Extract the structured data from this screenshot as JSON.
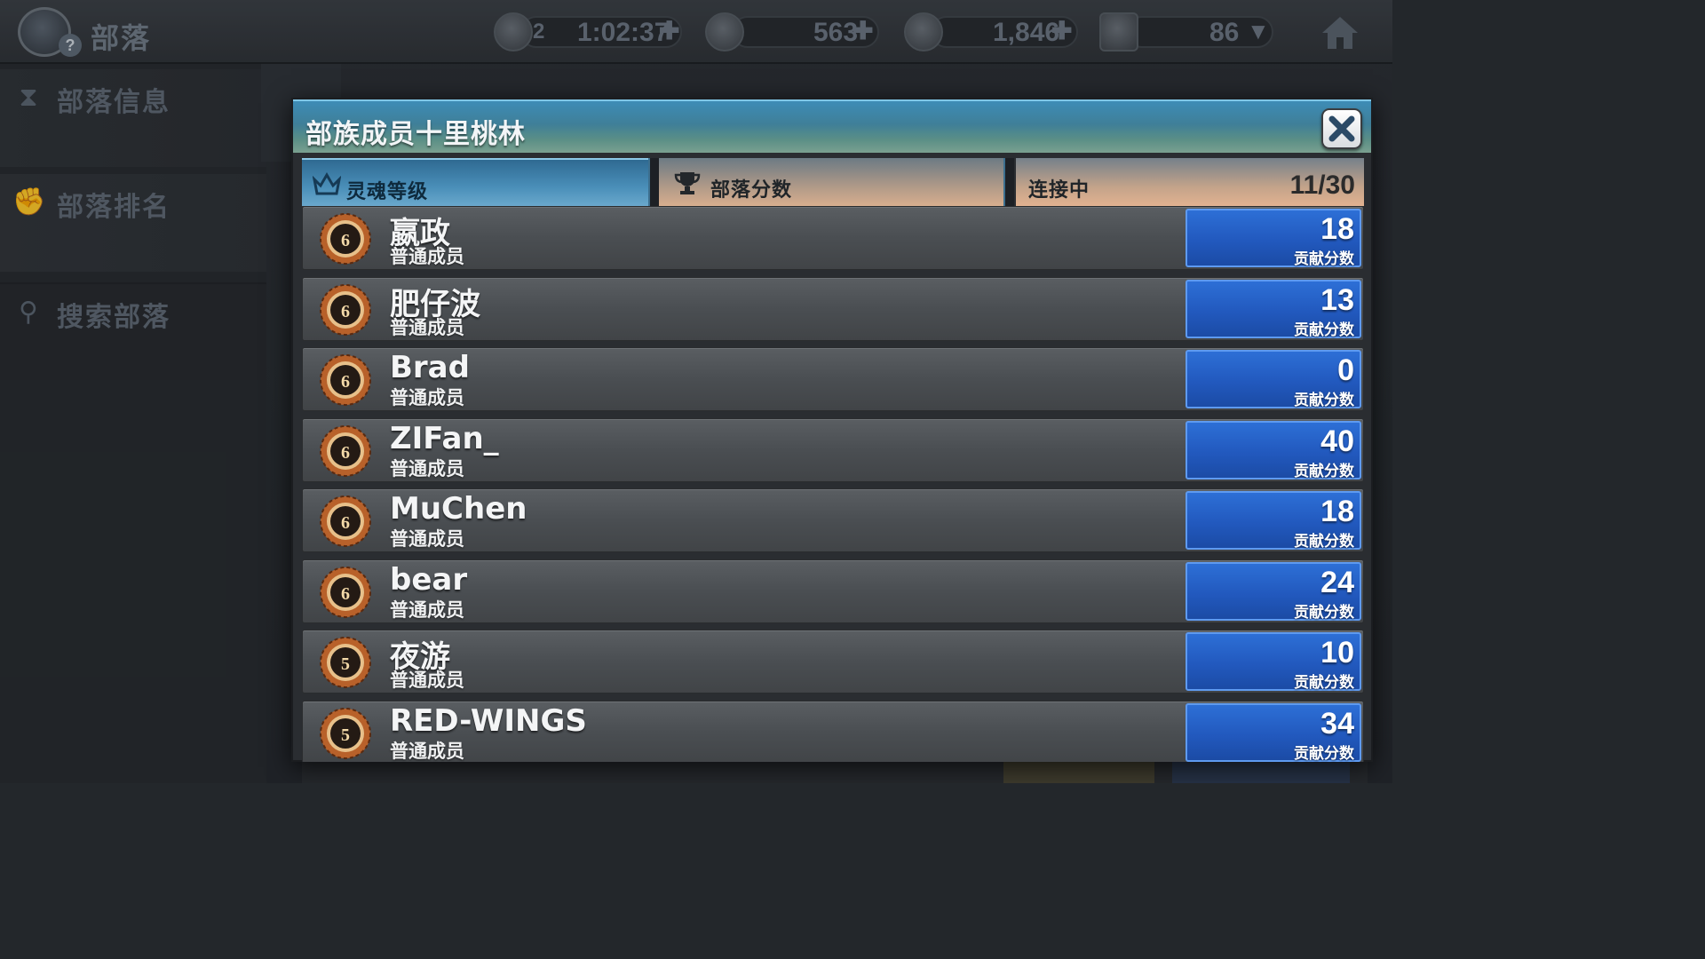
{
  "topbar": {
    "title": "部落",
    "help_glyph": "?",
    "timer": {
      "badge": "2",
      "value": "1:02:37"
    },
    "resource_a": {
      "value": "563"
    },
    "resource_b": {
      "value": "1,846"
    },
    "trophy": {
      "value": "86"
    },
    "plus_glyph": "✚",
    "dropdown_glyph": "▼"
  },
  "sidebar": {
    "items": [
      {
        "label": "部落信息",
        "icon": "hourglass-icon"
      },
      {
        "label": "部落排名",
        "icon": "fist-icon"
      },
      {
        "label": "搜索部落",
        "icon": "search-icon"
      }
    ]
  },
  "modal": {
    "title": "部族成员十里桃林",
    "tabs": {
      "soul": "灵魂等级",
      "score": "部落分数",
      "online": "连接中",
      "online_count": "11/30"
    },
    "members": [
      {
        "name": "嬴政",
        "role": "普通成员",
        "level": "6",
        "score": "18",
        "score_label": "贡献分数"
      },
      {
        "name": "肥仔波",
        "role": "普通成员",
        "level": "6",
        "score": "13",
        "score_label": "贡献分数"
      },
      {
        "name": "Brad",
        "role": "普通成员",
        "level": "6",
        "score": "0",
        "score_label": "贡献分数"
      },
      {
        "name": "ZIFan_",
        "role": "普通成员",
        "level": "6",
        "score": "40",
        "score_label": "贡献分数"
      },
      {
        "name": "MuChen",
        "role": "普通成员",
        "level": "6",
        "score": "18",
        "score_label": "贡献分数"
      },
      {
        "name": "bear",
        "role": "普通成员",
        "level": "6",
        "score": "24",
        "score_label": "贡献分数"
      },
      {
        "name": "夜游",
        "role": "普通成员",
        "level": "5",
        "score": "10",
        "score_label": "贡献分数"
      },
      {
        "name": "RED-WINGS",
        "role": "普通成员",
        "level": "5",
        "score": "34",
        "score_label": "贡献分数"
      }
    ]
  },
  "colors": {
    "header_blue": "#3e8cb6",
    "score_blue": "#2259be",
    "tab_active": "#4a8fb9",
    "row_gray": "#4a4e52"
  }
}
